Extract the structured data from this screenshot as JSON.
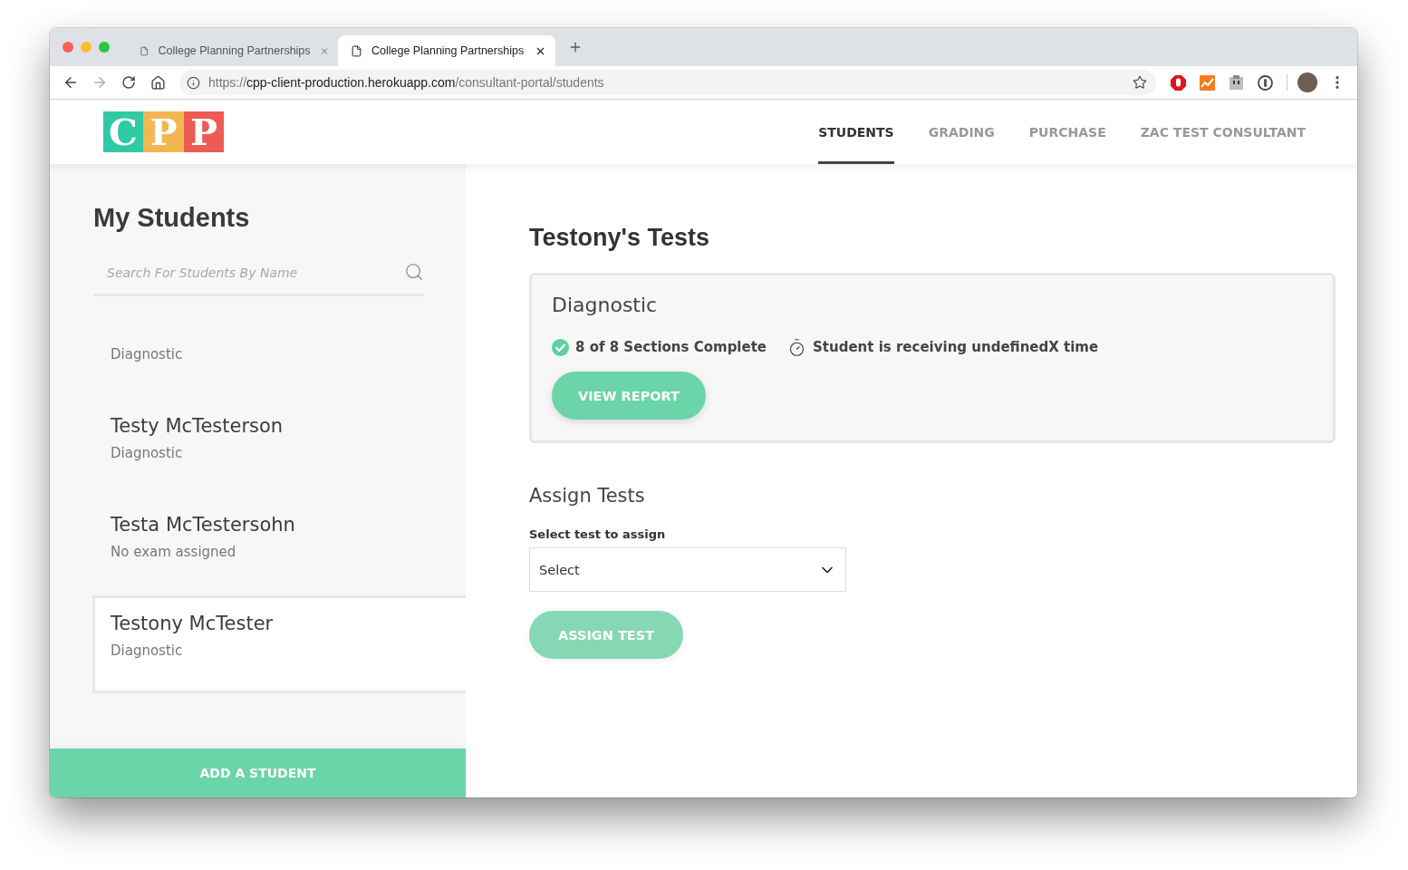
{
  "browser": {
    "tabs": [
      {
        "title": "College Planning Partnerships",
        "selected": false
      },
      {
        "title": "College Planning Partnerships",
        "selected": true
      }
    ],
    "address": {
      "scheme": "https://",
      "host": "cpp-client-production.herokuapp.com",
      "path": "/consultant-portal/students"
    }
  },
  "header": {
    "logo": [
      {
        "letter": "C",
        "color": "#30c9a6"
      },
      {
        "letter": "P",
        "color": "#f2b652"
      },
      {
        "letter": "P",
        "color": "#ec5b54"
      }
    ],
    "nav": [
      {
        "label": "STUDENTS",
        "selected": true
      },
      {
        "label": "GRADING",
        "selected": false
      },
      {
        "label": "PURCHASE",
        "selected": false
      },
      {
        "label": "ZAC TEST CONSULTANT",
        "selected": false
      }
    ]
  },
  "sidebar": {
    "title": "My Students",
    "search": {
      "placeholder": "Search For Students By Name"
    },
    "students": [
      {
        "status": "Diagnostic",
        "selected": false
      },
      {
        "name": "Testy McTesterson",
        "status": "Diagnostic",
        "selected": false
      },
      {
        "name": "Testa McTestersohn",
        "status": "No exam assigned",
        "selected": false
      },
      {
        "name": "Testony McTester",
        "status": "Diagnostic",
        "selected": true
      }
    ],
    "add_button": "ADD A STUDENT"
  },
  "main": {
    "title": "Testony's Tests",
    "tests": [
      {
        "name": "Diagnostic",
        "complete": true,
        "progress": "8 of 8 Sections Complete",
        "time_note": "Student is receiving undefinedX time",
        "button": "VIEW REPORT"
      }
    ],
    "assign": {
      "title": "Assign Tests",
      "label": "Select test to assign",
      "select": {
        "value": "Select"
      },
      "button": {
        "label": "ASSIGN TEST",
        "disabled": true
      }
    }
  }
}
